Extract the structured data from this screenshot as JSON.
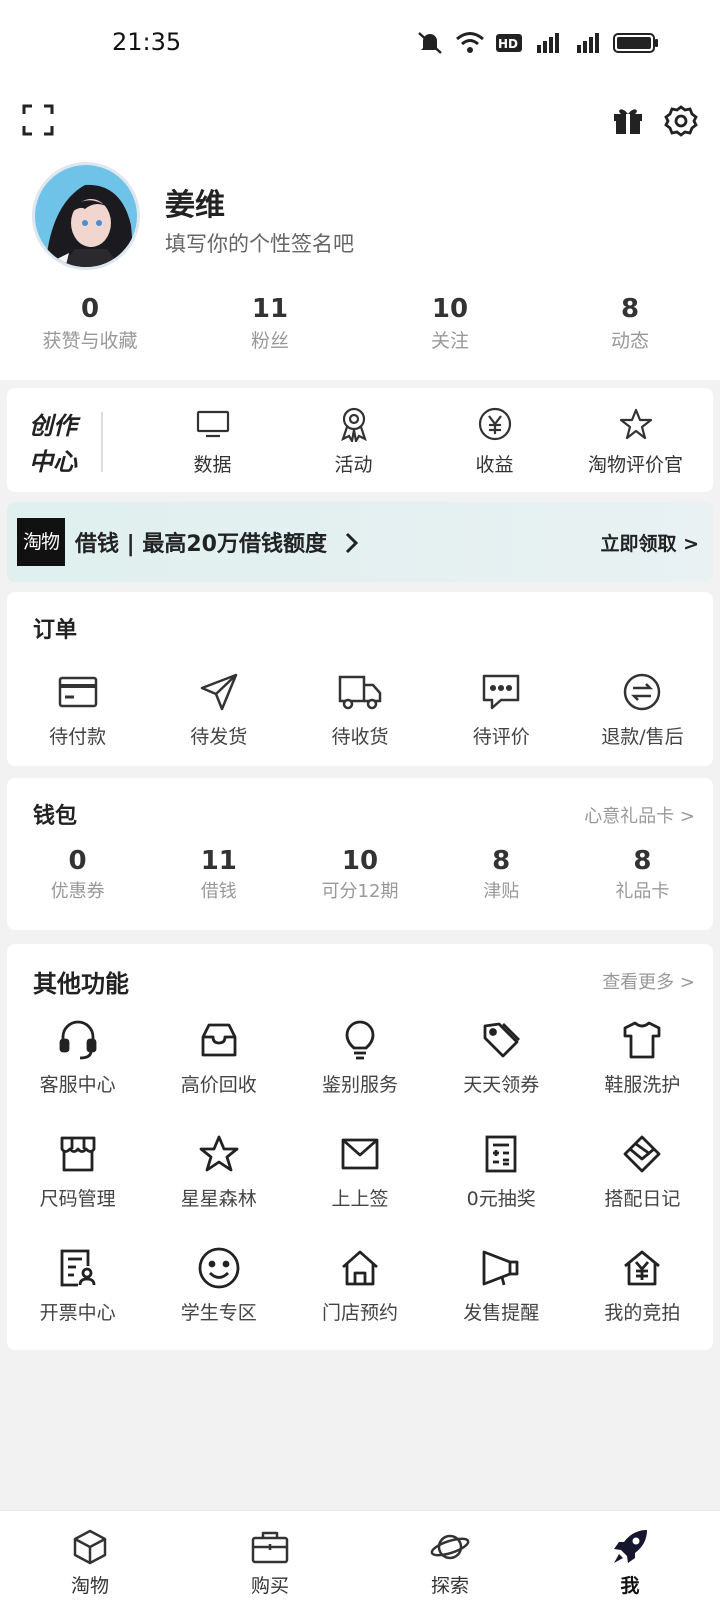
{
  "status_bar": {
    "time": "21:35"
  },
  "profile": {
    "name": "姜维",
    "bio": "填写你的个性签名吧",
    "stats": [
      {
        "num": "0",
        "label": "获赞与收藏"
      },
      {
        "num": "11",
        "label": "粉丝"
      },
      {
        "num": "10",
        "label": "关注"
      },
      {
        "num": "8",
        "label": "动态"
      }
    ]
  },
  "creator": {
    "title": "创作中心",
    "items": [
      {
        "label": "数据",
        "icon": "monitor-icon"
      },
      {
        "label": "活动",
        "icon": "award-icon"
      },
      {
        "label": "收益",
        "icon": "yen-circle-icon"
      },
      {
        "label": "淘物评价官",
        "icon": "star-icon"
      }
    ]
  },
  "loan_banner": {
    "logo": "淘物",
    "text": "借钱 | 最高20万借钱额度",
    "cta": "立即领取 >"
  },
  "orders": {
    "title": "订单",
    "items": [
      {
        "label": "待付款",
        "icon": "card-icon"
      },
      {
        "label": "待发货",
        "icon": "send-icon"
      },
      {
        "label": "待收货",
        "icon": "truck-icon"
      },
      {
        "label": "待评价",
        "icon": "comment-icon"
      },
      {
        "label": "退款/售后",
        "icon": "exchange-icon"
      }
    ]
  },
  "wallet": {
    "title": "钱包",
    "link": "心意礼品卡 >",
    "items": [
      {
        "num": "0",
        "label": "优惠券"
      },
      {
        "num": "11",
        "label": "借钱"
      },
      {
        "num": "10",
        "label": "可分12期"
      },
      {
        "num": "8",
        "label": "津贴"
      },
      {
        "num": "8",
        "label": "礼品卡"
      }
    ]
  },
  "functions": {
    "title": "其他功能",
    "link": "查看更多 >",
    "rows": [
      [
        {
          "label": "客服中心",
          "icon": "headset-icon"
        },
        {
          "label": "高价回收",
          "icon": "inbox-icon"
        },
        {
          "label": "鉴别服务",
          "icon": "bulb-icon"
        },
        {
          "label": "天天领券",
          "icon": "tag-icon"
        },
        {
          "label": "鞋服洗护",
          "icon": "shirt-icon"
        }
      ],
      [
        {
          "label": "尺码管理",
          "icon": "store-icon"
        },
        {
          "label": "星星森林",
          "icon": "star-icon"
        },
        {
          "label": "上上签",
          "icon": "mail-icon"
        },
        {
          "label": "0元抽奖",
          "icon": "lottery-icon"
        },
        {
          "label": "搭配日记",
          "icon": "cube-icon"
        }
      ],
      [
        {
          "label": "开票中心",
          "icon": "invoice-icon"
        },
        {
          "label": "学生专区",
          "icon": "smile-icon"
        },
        {
          "label": "门店预约",
          "icon": "house-icon"
        },
        {
          "label": "发售提醒",
          "icon": "megaphone-icon"
        },
        {
          "label": "我的竞拍",
          "icon": "auction-icon"
        }
      ]
    ]
  },
  "bottom_nav": [
    {
      "label": "淘物",
      "icon": "box-icon"
    },
    {
      "label": "购买",
      "icon": "briefcase-icon"
    },
    {
      "label": "探索",
      "icon": "planet-icon"
    },
    {
      "label": "我",
      "icon": "rocket-icon",
      "active": true
    }
  ]
}
